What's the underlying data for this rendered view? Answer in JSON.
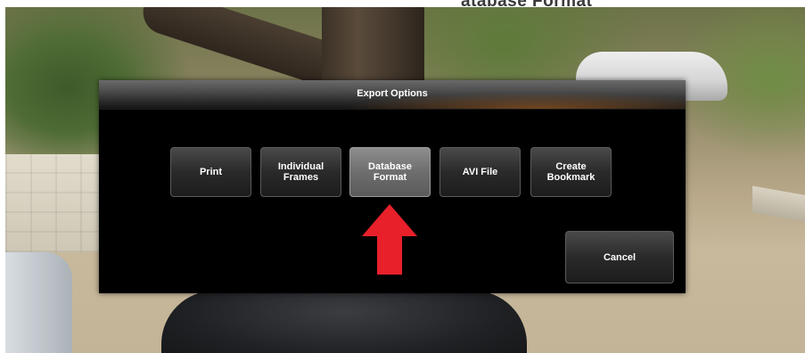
{
  "top_caption": "atabase Format",
  "dialog": {
    "title": "Export Options",
    "buttons": {
      "print": "Print",
      "individual_frames": "Individual\nFrames",
      "database_format": "Database\nFormat",
      "avi_file": "AVI File",
      "create_bookmark": "Create\nBookmark"
    },
    "selected": "database_format",
    "cancel": "Cancel"
  },
  "annotation": {
    "arrow_icon": "red-up-arrow-icon",
    "arrow_color": "#e8202a"
  },
  "colors": {
    "dialog_bg": "#000000",
    "title_text": "#ffffff",
    "button_text": "#ffffff"
  }
}
